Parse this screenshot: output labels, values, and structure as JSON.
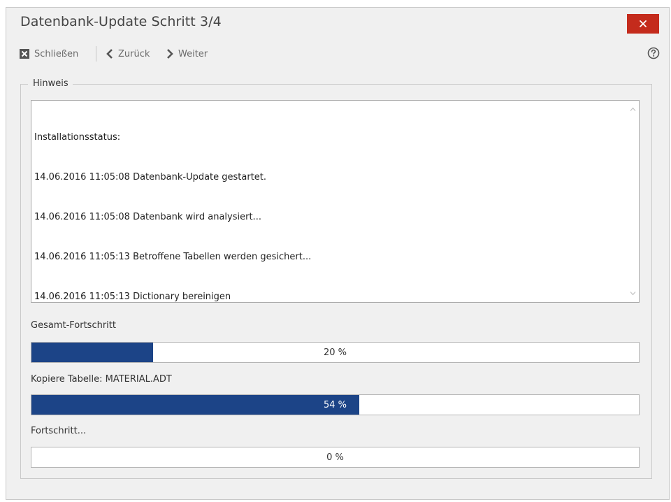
{
  "window": {
    "title": "Datenbank-Update Schritt 3/4"
  },
  "toolbar": {
    "close_label": "Schließen",
    "back_label": "Zurück",
    "next_label": "Weiter"
  },
  "group": {
    "legend": "Hinweis"
  },
  "log": {
    "lines": [
      "Installationsstatus:",
      "14.06.2016 11:05:08 Datenbank-Update gestartet.",
      "14.06.2016 11:05:08 Datenbank wird analysiert...",
      "14.06.2016 11:05:13 Betroffene Tabellen werden gesichert...",
      "14.06.2016 11:05:13 Dictionary bereinigen"
    ]
  },
  "progress": {
    "total": {
      "label": "Gesamt-Fortschritt",
      "percent": 20,
      "text": "20 %"
    },
    "table": {
      "label": "Kopiere Tabelle: MATERIAL.ADT",
      "percent": 54,
      "text": "54 %"
    },
    "step": {
      "label": "Fortschritt...",
      "percent": 0,
      "text": "0 %"
    }
  },
  "colors": {
    "progress_fill": "#1c4487",
    "close_button": "#c42b1c"
  },
  "icons": {
    "close_toolbar": "close-box-icon",
    "back": "chevron-left-icon",
    "next": "chevron-right-icon",
    "help": "help-circle-icon",
    "window_close": "close-x-icon"
  }
}
